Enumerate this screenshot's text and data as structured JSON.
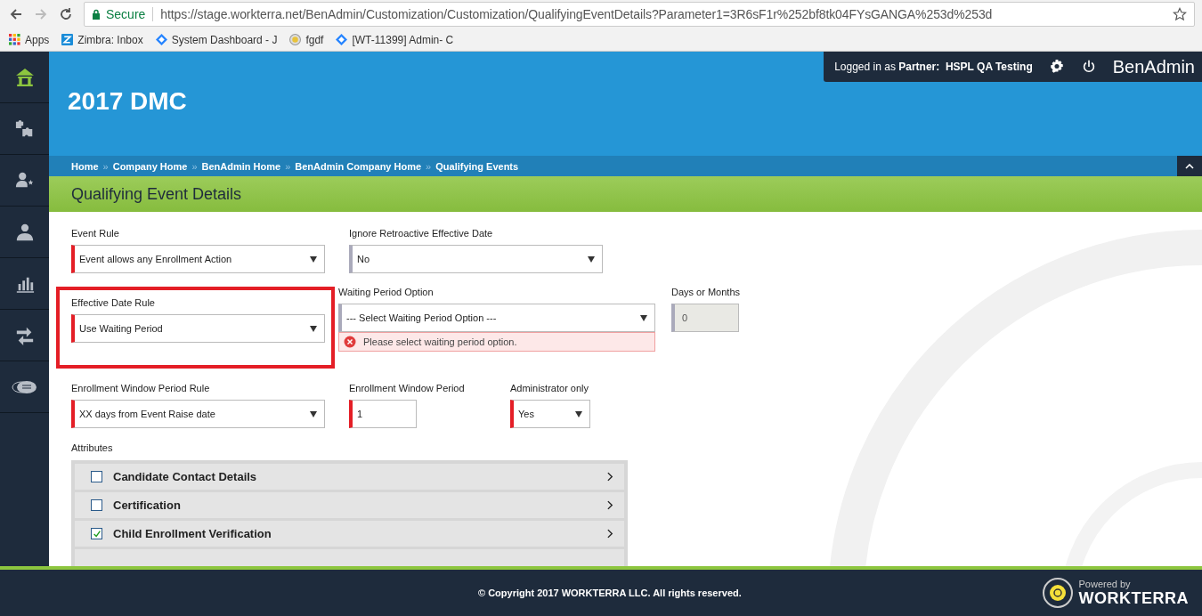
{
  "browser": {
    "secure_label": "Secure",
    "url": "https://stage.workterra.net/BenAdmin/Customization/Customization/QualifyingEventDetails?Parameter1=3R6sF1r%252bf8tk04FYsGANGA%253d%253d",
    "bookmarks": [
      {
        "kind": "apps",
        "label": "Apps"
      },
      {
        "kind": "zimbra",
        "label": "Zimbra: Inbox"
      },
      {
        "kind": "diamond",
        "label": "System Dashboard - J"
      },
      {
        "kind": "seal",
        "label": "fgdf"
      },
      {
        "kind": "diamond",
        "label": "[WT-11399] Admin- C"
      }
    ]
  },
  "sidebar": {
    "items": [
      {
        "kind": "home",
        "selected": true
      },
      {
        "kind": "puzzle",
        "selected": false
      },
      {
        "kind": "user-star",
        "selected": false
      },
      {
        "kind": "user",
        "selected": false
      },
      {
        "kind": "chart",
        "selected": false
      },
      {
        "kind": "arrows",
        "selected": false
      },
      {
        "kind": "chat",
        "selected": false
      }
    ]
  },
  "user_bar": {
    "prefix": "Logged in as",
    "role": "Partner:",
    "name": "HSPL QA Testing",
    "app": "BenAdmin"
  },
  "header": {
    "title": "2017 DMC"
  },
  "breadcrumb": {
    "separator": "»",
    "items": [
      "Home",
      "Company Home",
      "BenAdmin Home",
      "BenAdmin Company Home",
      "Qualifying Events"
    ]
  },
  "page_title": "Qualifying Event Details",
  "rows": [
    [
      {
        "kind": "select",
        "label": "Event Rule",
        "value": "Event allows any Enrollment Action",
        "required": true,
        "highlighted": false,
        "disabled": false
      },
      {
        "kind": "select",
        "label": "Ignore Retroactive Effective Date",
        "value": "No",
        "required": false,
        "highlighted": false,
        "disabled": false
      }
    ],
    [
      {
        "kind": "select",
        "label": "Effective Date Rule",
        "value": "Use Waiting Period",
        "required": true,
        "highlighted": true,
        "disabled": false
      },
      {
        "kind": "select",
        "label": "Waiting Period Option",
        "value": "--- Select Waiting Period Option ---",
        "required": false,
        "highlighted": false,
        "disabled": false,
        "error": "Please select waiting period option."
      },
      {
        "kind": "input",
        "label": "Days or Months",
        "value": "0",
        "required": false,
        "highlighted": false,
        "disabled": true
      }
    ],
    [
      {
        "kind": "select",
        "label": "Enrollment Window Period Rule",
        "value": "XX days from Event Raise date",
        "required": true,
        "highlighted": false,
        "disabled": false
      },
      {
        "kind": "input",
        "label": "Enrollment Window Period",
        "value": "1",
        "required": true,
        "highlighted": false,
        "disabled": false
      },
      {
        "kind": "select",
        "label": "Administrator only",
        "value": "Yes",
        "required": true,
        "highlighted": false,
        "disabled": false
      }
    ]
  ],
  "attributes": {
    "label": "Attributes",
    "items": [
      {
        "name": "Candidate Contact Details",
        "checked": false
      },
      {
        "name": "Certification",
        "checked": false
      },
      {
        "name": "Child Enrollment Verification",
        "checked": true
      }
    ]
  },
  "footer": {
    "copyright": "© Copyright 2017 WORKTERRA LLC. All rights reserved.",
    "powered_by": "Powered by",
    "brand": "WORKTERRA"
  }
}
